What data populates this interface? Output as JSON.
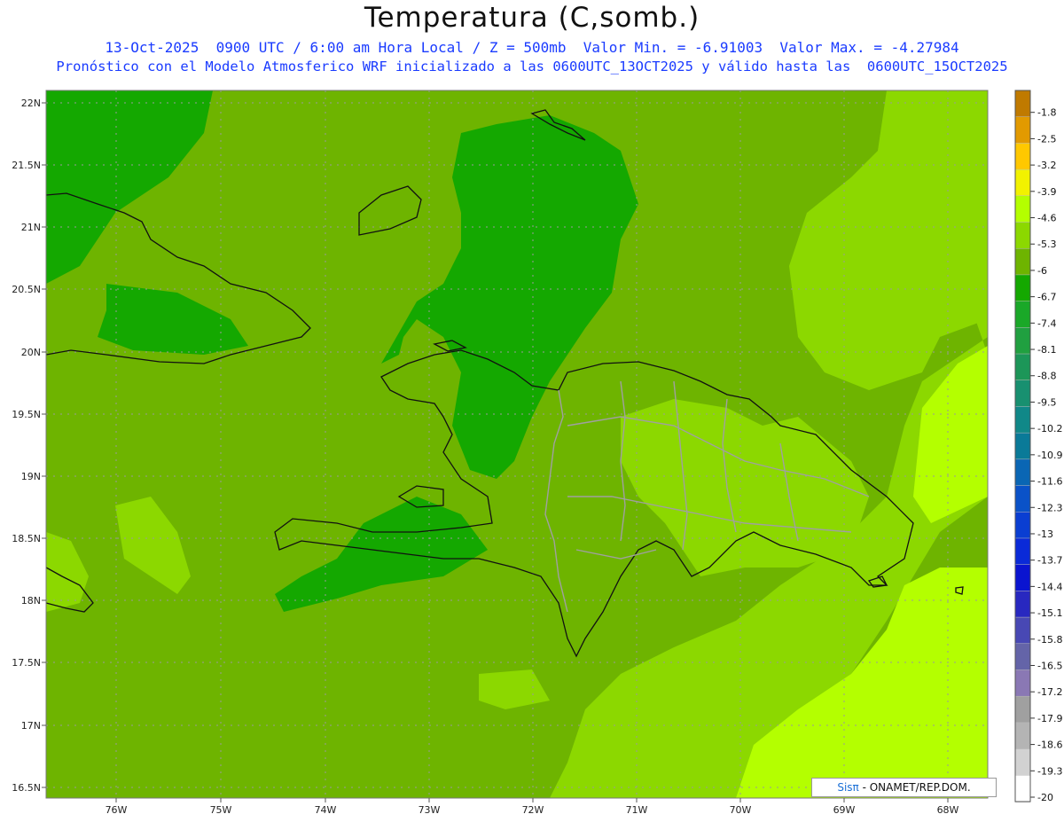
{
  "title": "Temperatura (C,somb.)",
  "subtitle_line1": "13-Oct-2025  0900 UTC / 6:00 am Hora Local / Z = 500mb  Valor Min. = -6.91003  Valor Max. = -4.27984",
  "subtitle_line2": "Pronóstico con el Modelo Atmosferico WRF inicializado a las 0600UTC_13OCT2025 y válido hasta las  0600UTC_15OCT2025",
  "lat_labels": [
    "22N",
    "21.5N",
    "21N",
    "20.5N",
    "20N",
    "19.5N",
    "19N",
    "18.5N",
    "18N",
    "17.5N",
    "17N",
    "16.5N"
  ],
  "lon_labels": [
    "76W",
    "75W",
    "74W",
    "73W",
    "72W",
    "71W",
    "70W",
    "69W",
    "68W"
  ],
  "colorbar": {
    "labels": [
      "-1.8",
      "-2.5",
      "-3.2",
      "-3.9",
      "-4.6",
      "-5.3",
      "-6",
      "-6.7",
      "-7.4",
      "-8.1",
      "-8.8",
      "-9.5",
      "-10.2",
      "-10.9",
      "-11.6",
      "-12.3",
      "-13",
      "-13.7",
      "-14.4",
      "-15.1",
      "-15.8",
      "-16.5",
      "-17.2",
      "-17.9",
      "-18.6",
      "-19.3",
      "-20"
    ],
    "colors": [
      "#c07a00",
      "#e29a00",
      "#ffc800",
      "#f2f200",
      "#b4ff00",
      "#8cd800",
      "#6eb400",
      "#14a800",
      "#1aa828",
      "#20a040",
      "#1c9658",
      "#189070",
      "#108888",
      "#0a7a98",
      "#0a66b4",
      "#0a52c8",
      "#0a3ed2",
      "#0a2ad8",
      "#0a14d0",
      "#2828c0",
      "#4848b4",
      "#6464a8",
      "#8a78b4",
      "#a0a0a0",
      "#b4b4b4",
      "#d2d2d2",
      "#ffffff"
    ]
  },
  "field_colors": {
    "base": "#6eb400",
    "cold": "#14a800",
    "warm": "#8cd800",
    "warmer": "#b4ff00"
  },
  "credit": {
    "brand": "Sis",
    "pi": "π",
    "text": " -  ONAMET/REP.DOM."
  }
}
